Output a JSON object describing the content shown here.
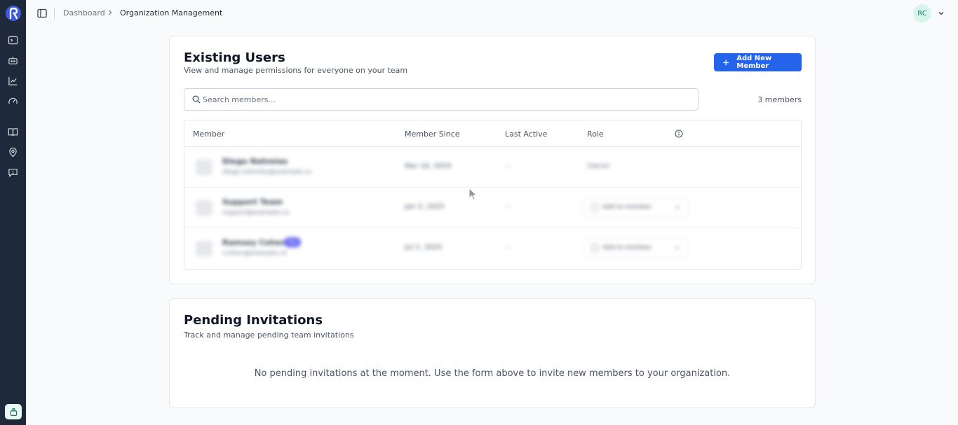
{
  "header": {
    "breadcrumb_home": "Dashboard",
    "breadcrumb_current": "Organization Management",
    "user_initials": "RC"
  },
  "sidebar": {
    "icons": [
      "terminal-icon",
      "bot-icon",
      "chart-line-icon",
      "gauge-icon",
      "book-open-icon",
      "map-pin-icon",
      "message-square-icon"
    ],
    "bottom_icon": "layers-icon"
  },
  "existing_users": {
    "title": "Existing Users",
    "subtitle": "View and manage permissions for everyone on your team",
    "add_button": "Add New Member",
    "search_placeholder": "Search members...",
    "member_count": "3 members",
    "columns": [
      "Member",
      "Member Since",
      "Last Active",
      "Role"
    ],
    "rows": [
      {
        "name": "Diego Nahmias",
        "email": "diego.nahmias@example.co",
        "badge": "",
        "since": "Mar 18, 2024",
        "last_active": "—",
        "role": "Owner",
        "role_editable": false
      },
      {
        "name": "Support Team",
        "email": "support@example.co",
        "badge": "",
        "since": "Jan 3, 2025",
        "last_active": "—",
        "role": "Add to member",
        "role_editable": true
      },
      {
        "name": "Ramsey Cohen",
        "email": "rcohen@example.co",
        "badge": "You",
        "since": "Jul 2, 2025",
        "last_active": "—",
        "role": "Add to member",
        "role_editable": true
      }
    ]
  },
  "pending_invitations": {
    "title": "Pending Invitations",
    "subtitle": "Track and manage pending team invitations",
    "empty_message": "No pending invitations at the moment. Use the form above to invite new members to your organization."
  },
  "colors": {
    "sidebar_bg": "#1e2a3b",
    "primary": "#2563eb",
    "avatar_bg": "#d8f5ec"
  }
}
